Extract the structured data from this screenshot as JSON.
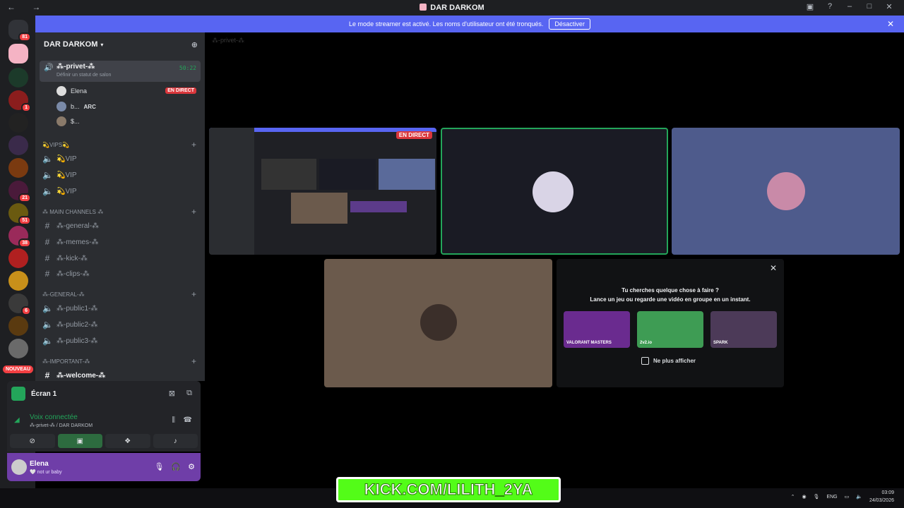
{
  "window": {
    "title": "DAR DARKOM",
    "nav": "← →"
  },
  "banner": {
    "text": "Le mode streamer est activé. Les noms d'utilisateur ont été tronqués.",
    "button": "Désactiver"
  },
  "server": {
    "name": "DAR DARKOM"
  },
  "servers": {
    "badges": [
      "81",
      "1",
      "21",
      "51",
      "38",
      "6"
    ],
    "new_label": "NOUVEAU"
  },
  "channels": {
    "active": {
      "name": "⁂-privet-⁂",
      "status": "Définir un statut de salon",
      "timer": "50:22"
    },
    "voice_users": [
      {
        "name": "Elena",
        "live": "EN DIRECT"
      },
      {
        "name": "b...",
        "tag": "ARC"
      },
      {
        "name": "$..."
      }
    ],
    "categories": [
      {
        "name": "💫VIPS💫",
        "items": [
          "💫VIP",
          "💫VIP",
          "💫VIP"
        ],
        "kind": "voice"
      },
      {
        "name": "⁂ MAIN CHANNELS ⁂",
        "items": [
          "⁂-general-⁂",
          "⁂-memes-⁂",
          "⁂-kick-⁂",
          "⁂-clips-⁂"
        ],
        "kind": "text"
      },
      {
        "name": "⁂-GENERAL-⁂",
        "items": [
          "⁂-public1-⁂",
          "⁂-public2-⁂",
          "⁂-public3-⁂"
        ],
        "kind": "voice"
      },
      {
        "name": "⁂-important-⁂",
        "items": [
          "⁂-welcome-⁂"
        ],
        "kind": "text"
      }
    ]
  },
  "panel": {
    "stream": "Écran 1",
    "voice": "Voix connectée",
    "voice_sub": "⁂-privet-⁂ / DAR DARKOM"
  },
  "user": {
    "name": "Elena",
    "status": "🤍 not ur baby"
  },
  "stage": {
    "header": "⁂-privet-⁂",
    "live": "EN DIRECT",
    "activity": {
      "line1": "Tu cherches quelque chose à faire ?",
      "line2": "Lance un jeu ou regarde une vidéo en groupe en un instant.",
      "games": [
        "VALORANT MASTERS",
        "2v2.io",
        "SPARK"
      ],
      "checkbox": "Ne plus afficher"
    }
  },
  "overlay": {
    "kick": "KICK.COM/LILITH_2YA"
  },
  "tray": {
    "lang": "ENG",
    "time": "03:09",
    "date": "24/03/2026"
  },
  "colors": {
    "accent": "#5865f2",
    "online": "#23a55a",
    "live": "#da373c",
    "kick": "#53fc18"
  }
}
